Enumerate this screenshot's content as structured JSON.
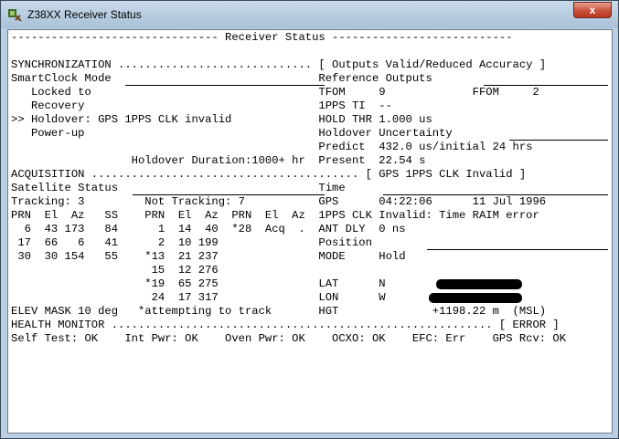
{
  "window": {
    "title": "Z38XX Receiver Status",
    "close_glyph": "x"
  },
  "icons": {
    "app": "satellite-dish-icon",
    "close": "close-icon"
  },
  "lines": [
    "------------------------------- Receiver Status ---------------------------",
    "",
    "SYNCHRONIZATION ............................. [ Outputs Valid/Reduced Accuracy ]",
    "SmartClock Mode                               Reference Outputs",
    "   Locked to                                  TFOM     9             FFOM     2",
    "   Recovery                                   1PPS TI  --",
    ">> Holdover: GPS 1PPS CLK invalid             HOLD THR 1.000 us",
    "   Power-up                                   Holdover Uncertainty",
    "                                              Predict  432.0 us/initial 24 hrs",
    "                  Holdover Duration:1000+ hr  Present  22.54 s",
    "ACQUISITION ........................................ [ GPS 1PPS CLK Invalid ]",
    "Satellite Status                              Time",
    "Tracking: 3         Not Tracking: 7           GPS      04:22:06      11 Jul 1996",
    "PRN  El  Az   SS    PRN  El  Az  PRN  El  Az  1PPS CLK Invalid: Time RAIM error",
    "  6  43 173   84      1  14  40  *28  Acq  .  ANT DLY  0 ns",
    " 17  66   6   41      2  10 199               Position",
    " 30  30 154   55    *13  21 237               MODE     Hold",
    "                     15  12 276",
    "                    *19  65 275               LAT      N",
    "                     24  17 317               LON      W",
    "ELEV MASK 10 deg   *attempting to track       HGT              +1198.22 m  (MSL)",
    "HEALTH MONITOR ......................................................... [ ERROR ]",
    "Self Test: OK    Int Pwr: OK    Oven Pwr: OK    OCXO: OK    EFC: Err    GPS Rcv: OK"
  ]
}
